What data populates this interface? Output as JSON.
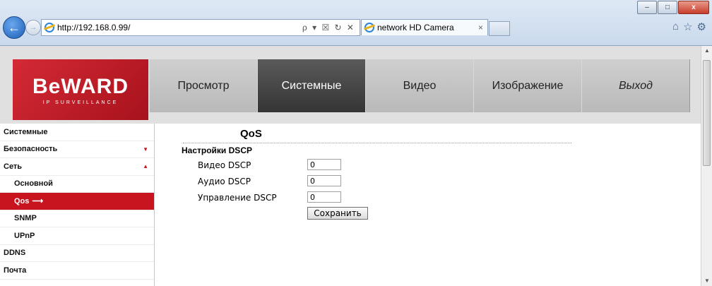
{
  "window": {
    "minimize": "–",
    "maximize": "□",
    "close": "x"
  },
  "browser": {
    "back_icon": "back-arrow-icon",
    "forward_icon": "forward-arrow-icon",
    "url": "http://192.168.0.99/",
    "addr_tools": "ρ ▾ ☒ ↻ ✕",
    "tab_title": "network HD Camera",
    "tab_close": "×",
    "toolbar_icons": [
      "home-icon",
      "star-icon",
      "gear-icon"
    ]
  },
  "logo": {
    "main": "BeWARD",
    "sub": "IP SURVEILLANCE"
  },
  "menu": [
    {
      "label": "Просмотр",
      "active": false
    },
    {
      "label": "Системные",
      "active": true
    },
    {
      "label": "Видео",
      "active": false
    },
    {
      "label": "Изображение",
      "active": false
    },
    {
      "label": "Выход",
      "active": false
    }
  ],
  "sidebar": [
    {
      "label": "Системные"
    },
    {
      "label": "Безопасность",
      "arrow": "▼"
    },
    {
      "label": "Сеть",
      "arrow": "▲"
    },
    {
      "label": "Основной"
    },
    {
      "label": "Qos",
      "arrow": "⟶"
    },
    {
      "label": "SNMP"
    },
    {
      "label": "UPnP"
    },
    {
      "label": "DDNS"
    },
    {
      "label": "Почта"
    }
  ],
  "content": {
    "title": "QoS",
    "section": "Настройки DSCP",
    "fields": [
      {
        "label": "Видео DSCP",
        "value": "0"
      },
      {
        "label": "Аудио DSCP",
        "value": "0"
      },
      {
        "label": "Управление DSCP",
        "value": "0"
      }
    ],
    "save_label": "Сохранить"
  },
  "colors": {
    "brand_red": "#c7141e",
    "menu_active": "#404040"
  }
}
